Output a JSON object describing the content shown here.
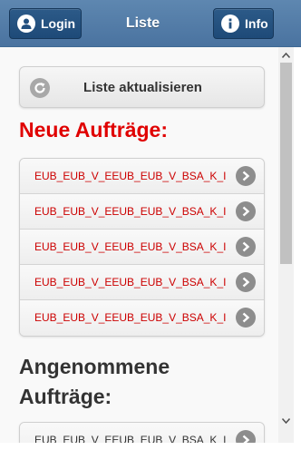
{
  "header": {
    "title": "Liste",
    "login_label": "Login",
    "info_label": "Info"
  },
  "refresh": {
    "label": "Liste aktualisieren"
  },
  "sections": {
    "new_title": "Neue Aufträge:",
    "accepted_title": "Angenommene Aufträge:"
  },
  "new_orders": [
    "EUB_EUB_V_EEUB_EUB_V_BSA_K_I",
    "EUB_EUB_V_EEUB_EUB_V_BSA_K_I",
    "EUB_EUB_V_EEUB_EUB_V_BSA_K_I",
    "EUB_EUB_V_EEUB_EUB_V_BSA_K_I",
    "EUB_EUB_V_EEUB_EUB_V_BSA_K_I"
  ],
  "accepted_orders": [
    "EUB_EUB_V_EEUB_EUB_V_BSA_K_I"
  ],
  "colors": {
    "header": "#4f7aa6",
    "header_button": "#23507f",
    "new_title": "#e00000",
    "order_text": "#cc0000",
    "chevron": "#8d8d8d"
  },
  "icons": {
    "login": "user-icon",
    "info": "info-icon",
    "refresh": "refresh-icon",
    "item": "chevron-right-icon"
  }
}
